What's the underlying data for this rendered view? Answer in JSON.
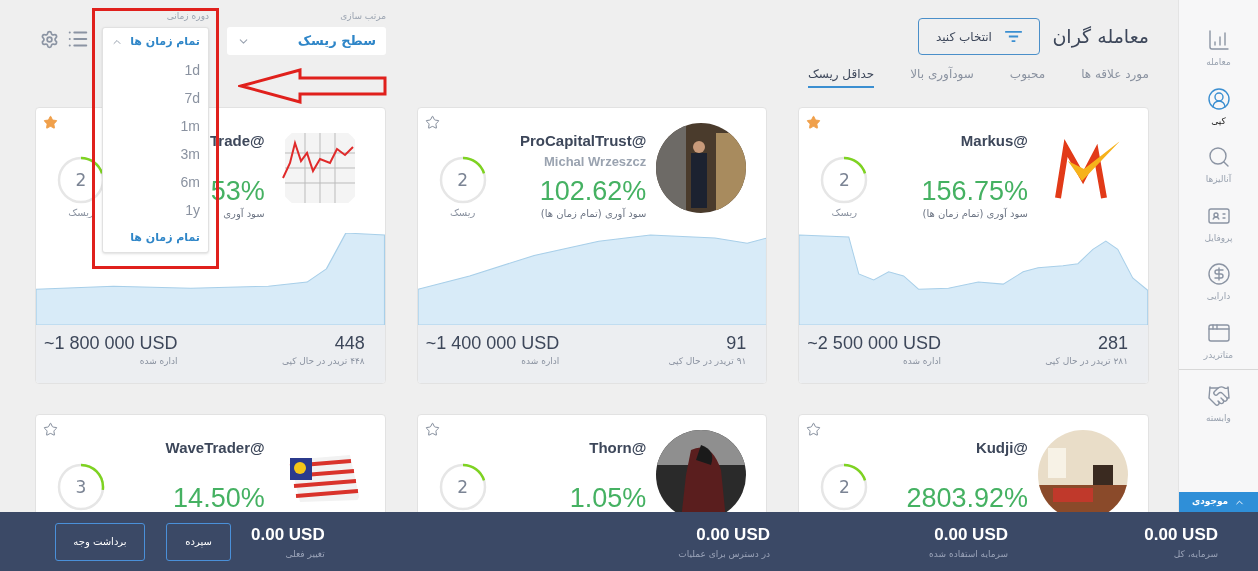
{
  "header": {
    "title": "معامله گران",
    "filter_button": "انتخاب کنید",
    "tabs": [
      {
        "label": "مورد علاقه ها",
        "selected": false
      },
      {
        "label": "محبوب",
        "selected": false
      },
      {
        "label": "سودآوری بالا",
        "selected": false
      },
      {
        "label": "حداقل ریسک",
        "selected": true
      }
    ],
    "sort": {
      "label": "مرتب سازی",
      "value": "سطح ریسک"
    },
    "period": {
      "label": "دوره زمانی",
      "value": "تمام زمان ها",
      "expanded": true,
      "options": [
        {
          "label": "1d",
          "selected": false
        },
        {
          "label": "7d",
          "selected": false
        },
        {
          "label": "1m",
          "selected": false
        },
        {
          "label": "3m",
          "selected": false
        },
        {
          "label": "6m",
          "selected": false
        },
        {
          "label": "1y",
          "selected": false
        },
        {
          "label": "تمام زمان ها",
          "selected": true
        }
      ]
    }
  },
  "traders": [
    {
      "favorite": true,
      "name": "Markus@",
      "profit": "156.75%",
      "profit_label": "سود آوری (تمام زمان ها)",
      "risk": "2",
      "level": 0.2,
      "risk_label": "ریسک",
      "managed": "~2 500 000 USD",
      "managed_label": "اداره شده",
      "copiers": "281",
      "copiers_label": "۲۸۱ تریدر در حال کپی"
    },
    {
      "favorite": false,
      "name": "ProCapitalTrust@",
      "subtitle": "Michal Wrzeszcz",
      "profit": "102.62%",
      "profit_label": "سود آوری (تمام زمان ها)",
      "risk": "2",
      "level": 0.2,
      "risk_label": "ریسک",
      "managed": "~1 400 000 USD",
      "managed_label": "اداره شده",
      "copiers": "91",
      "copiers_label": "۹۱ تریدر در حال کپی"
    },
    {
      "favorite": true,
      "name": "Trade@",
      "profit": "53%",
      "profit_label": "سود آوری",
      "risk": "2",
      "level": 0.2,
      "risk_label": "ریسک",
      "managed": "~1 800 000 USD",
      "managed_label": "اداره شده",
      "copiers": "448",
      "copiers_label": "۴۴۸ تریدر در حال کپی"
    },
    {
      "favorite": false,
      "name": "Kudji@",
      "profit": "2803.92%",
      "risk": "2",
      "level": 0.2
    },
    {
      "favorite": false,
      "name": "Thorn@",
      "profit": "1.05%",
      "risk": "2",
      "level": 0.2
    },
    {
      "favorite": false,
      "name": "WaveTrader@",
      "profit": "14.50%",
      "risk": "3",
      "level": 0.27
    }
  ],
  "sidebar": {
    "sections": [
      {
        "items": [
          {
            "label": "معامله",
            "selected": false
          },
          {
            "label": "کپی",
            "selected": true
          },
          {
            "label": "آنالیزها",
            "selected": false
          },
          {
            "label": "پروفایل",
            "selected": false
          },
          {
            "label": "دارایی",
            "selected": false
          },
          {
            "label": "متاتریدر",
            "selected": false
          }
        ]
      },
      {
        "items": [
          {
            "label": "وابسته",
            "selected": false
          }
        ]
      }
    ],
    "balance_tab": "موجودی"
  },
  "footer": {
    "stats": [
      {
        "value": "0.00 USD",
        "label": "سرمایه، کل"
      },
      {
        "value": "0.00 USD",
        "label": "سرمایه استفاده شده"
      },
      {
        "value": "0.00 USD",
        "label": "در دسترس برای عملیات"
      },
      {
        "value": "0.00 USD",
        "label": "تغییر فعلی"
      }
    ],
    "buttons": [
      "سپرده",
      "برداشت وجه"
    ]
  }
}
